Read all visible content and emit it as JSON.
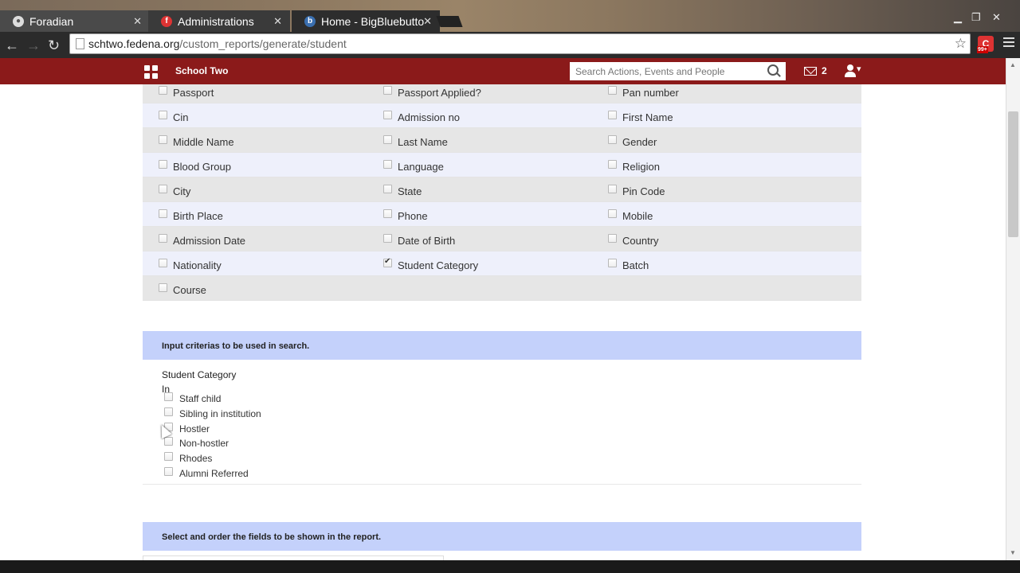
{
  "browser": {
    "tabs": [
      {
        "label": "Foradian",
        "icon": "foradian-favicon"
      },
      {
        "label": "Administrations",
        "icon": "f-favicon"
      },
      {
        "label": "Home - BigBluebutto",
        "icon": "b-favicon"
      }
    ],
    "url_host": "schtwo.fedena.org",
    "url_path": "/custom_reports/generate/student",
    "extension_badge": "99+"
  },
  "header": {
    "school_name": "School Two",
    "search_placeholder": "Search Actions, Events and People",
    "mail_count": "2"
  },
  "fields": [
    [
      "Passport",
      "Passport Applied?",
      "Pan number"
    ],
    [
      "Cin",
      "Admission no",
      "First Name"
    ],
    [
      "Middle Name",
      "Last Name",
      "Gender"
    ],
    [
      "Blood Group",
      "Language",
      "Religion"
    ],
    [
      "City",
      "State",
      "Pin Code"
    ],
    [
      "Birth Place",
      "Phone",
      "Mobile"
    ],
    [
      "Admission Date",
      "Date of Birth",
      "Country"
    ],
    [
      "Nationality",
      "Student Category",
      "Batch"
    ],
    [
      "Course"
    ]
  ],
  "checked_field": "Student Category",
  "criteria": {
    "heading": "Input criterias to be used in search.",
    "field_label": "Student Category",
    "operator": "In",
    "options": [
      "Staff child",
      "Sibling in institution",
      "Hostler",
      "Non-hostler",
      "Rhodes",
      "Alumni Referred"
    ]
  },
  "order_section": {
    "heading": "Select and order the fields to be shown in the report."
  }
}
